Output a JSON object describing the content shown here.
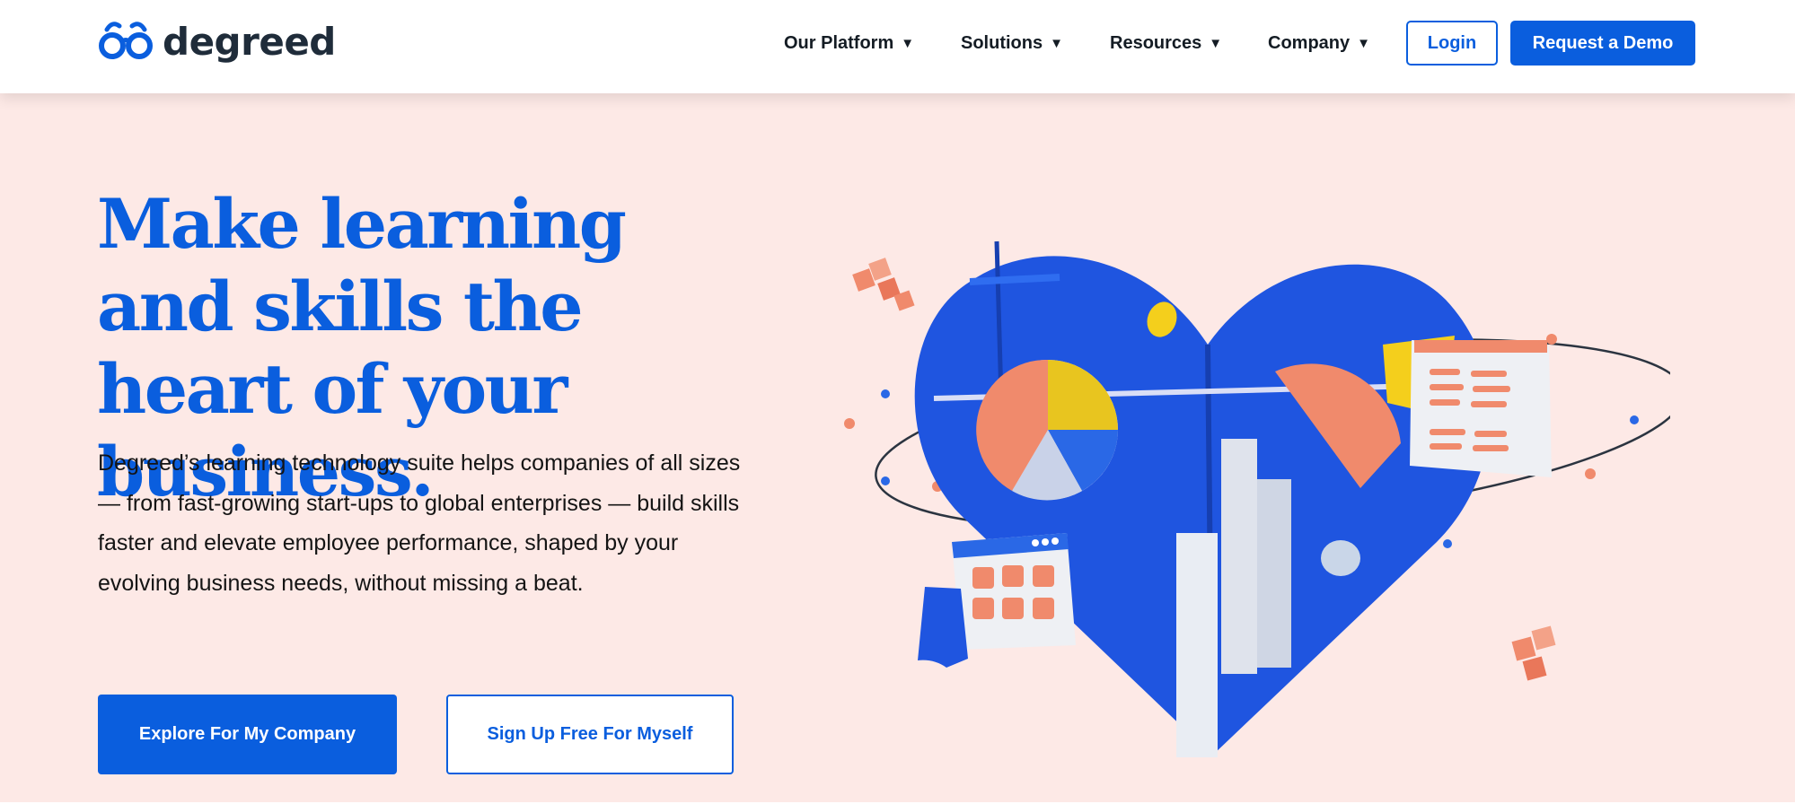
{
  "brand": {
    "name": "degreed",
    "logo_icon": "glasses-icon",
    "primary_color": "#0a5ede",
    "hero_background": "#fde9e6"
  },
  "nav": {
    "items": [
      {
        "label": "Our Platform",
        "caret": "▼"
      },
      {
        "label": "Solutions",
        "caret": "▼"
      },
      {
        "label": "Resources",
        "caret": "▼"
      },
      {
        "label": "Company",
        "caret": "▼"
      }
    ],
    "login_label": "Login",
    "demo_label": "Request a Demo"
  },
  "hero": {
    "headline": "Make learning and skills the heart of your business.",
    "description": "Degreed’s learning technology suite helps companies of all sizes — from fast-growing start-ups to global enterprises — build skills faster and elevate employee performance, shaped by your evolving business needs, without missing a beat.",
    "cta_primary": "Explore For My Company",
    "cta_secondary": "Sign Up Free For Myself"
  }
}
